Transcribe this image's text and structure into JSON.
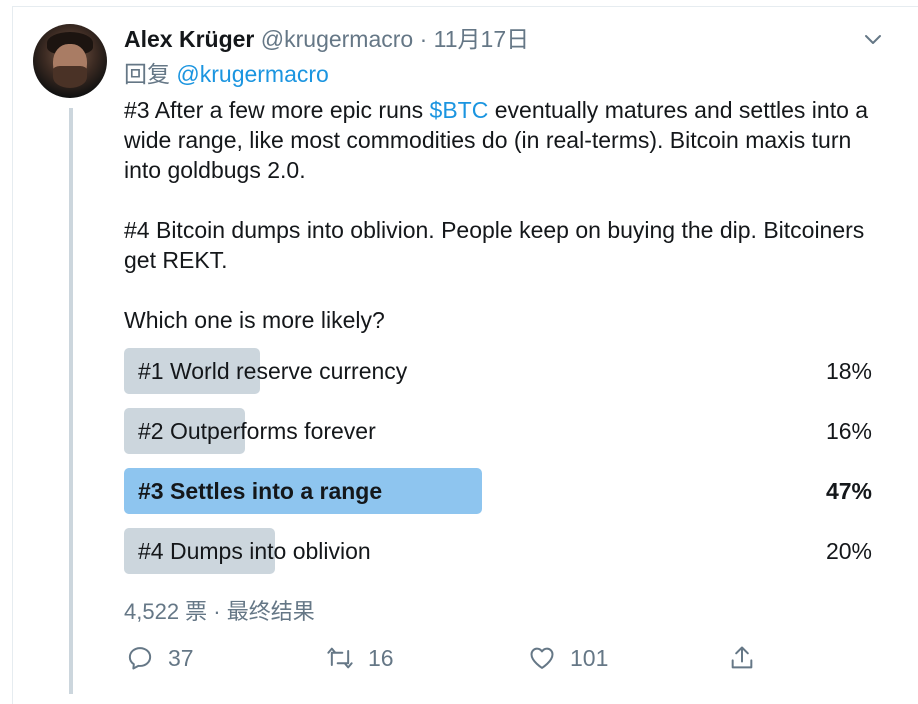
{
  "tweet": {
    "author_name": "Alex Krüger",
    "author_handle": "@krugermacro",
    "separator": "·",
    "date": "11月17日",
    "reply_prefix": "回复",
    "reply_to": "@krugermacro",
    "text_part1": "#3 After a few more epic runs ",
    "cashtag": "$BTC",
    "text_part2": " eventually matures and settles into a wide range, like most commodities do (in real-terms). Bitcoin maxis turn into goldbugs 2.0.\n\n#4 Bitcoin dumps into oblivion. People keep on buying the dip. Bitcoiners get REKT.",
    "question": "Which one is more likely?"
  },
  "poll": {
    "options": [
      {
        "label": "#1 World reserve currency",
        "percent_label": "18%",
        "percent": 18
      },
      {
        "label": "#2 Outperforms forever",
        "percent_label": "16%",
        "percent": 16
      },
      {
        "label": "#3 Settles into a range",
        "percent_label": "47%",
        "percent": 47
      },
      {
        "label": "#4 Dumps into oblivion",
        "percent_label": "20%",
        "percent": 20
      }
    ],
    "footer": "4,522 票 · 最终结果",
    "bar_color": "#ccd6dd",
    "winner_color": "#8ec5ef"
  },
  "actions": {
    "reply_count": "37",
    "retweet_count": "16",
    "like_count": "101",
    "reply_icon": "reply-icon",
    "retweet_icon": "retweet-icon",
    "like_icon": "heart-icon",
    "share_icon": "share-icon"
  },
  "colors": {
    "link": "#1b95e0",
    "secondary_text": "#657786",
    "thread_line": "#ccd6dd"
  }
}
